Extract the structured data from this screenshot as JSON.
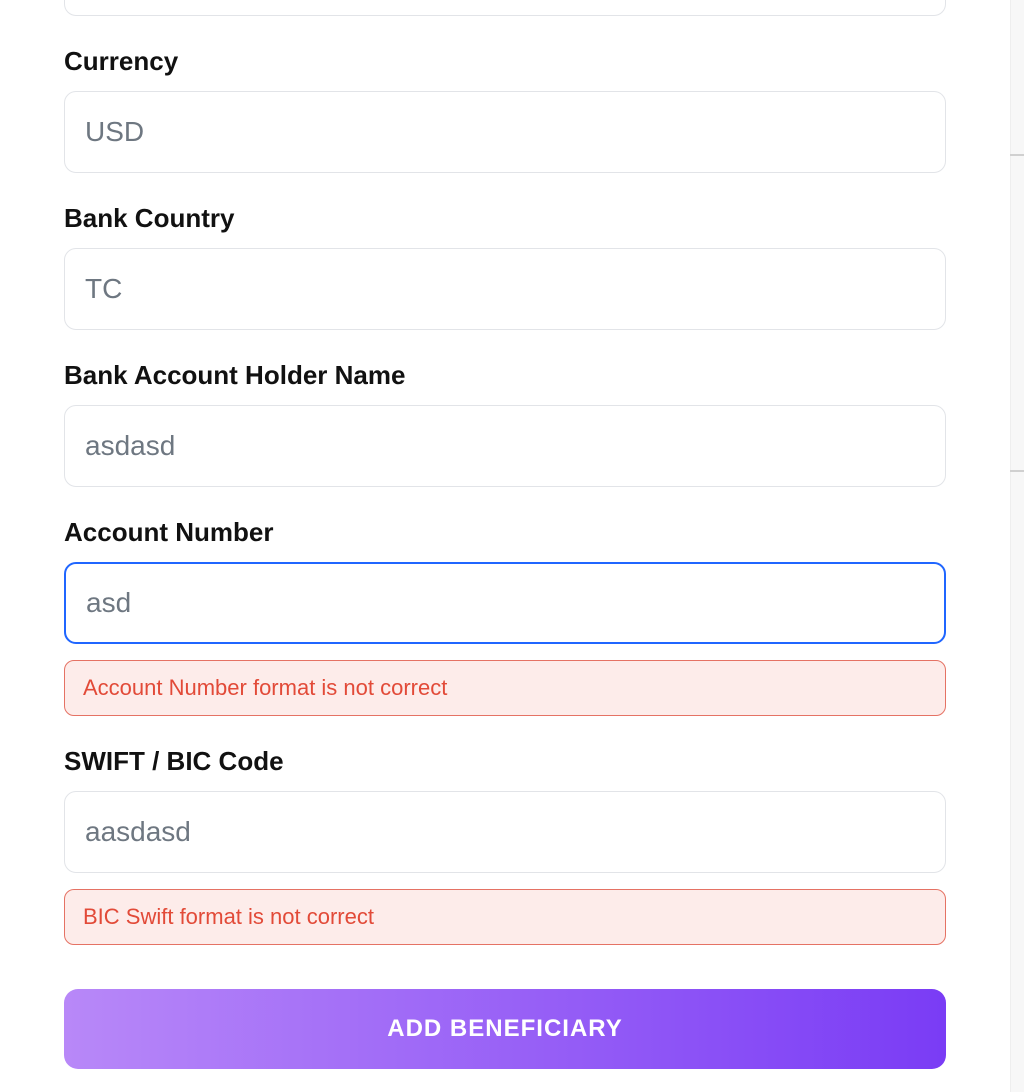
{
  "form": {
    "currency": {
      "label": "Currency",
      "value": "USD"
    },
    "bank_country": {
      "label": "Bank Country",
      "value": "TC"
    },
    "account_holder": {
      "label": "Bank Account Holder Name",
      "value": "asdasd"
    },
    "account_number": {
      "label": "Account Number",
      "value": "asd",
      "error": "Account Number format is not correct"
    },
    "swift_bic": {
      "label": "SWIFT / BIC Code",
      "value": "aasdasd",
      "error": "BIC Swift format is not correct"
    },
    "submit_label": "ADD BENEFICIARY"
  },
  "colors": {
    "input_border": "#e2e4e8",
    "focus_border": "#2066ff",
    "error_border": "#e57264",
    "error_bg": "#fdecea",
    "error_text": "#e24a38",
    "button_gradient_start": "#b888f8",
    "button_gradient_end": "#7a3cf5"
  }
}
